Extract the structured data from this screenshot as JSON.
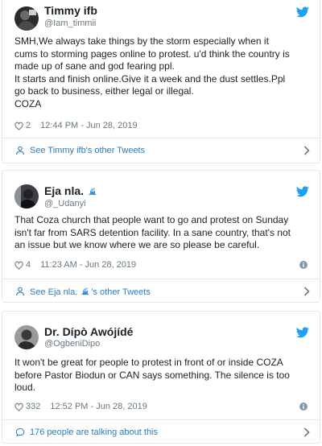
{
  "tweets": [
    {
      "name": "Timmy ifb",
      "handle": "@Iam_timmii",
      "text_lines": [
        "SMH,We always take things by the storm especially when it",
        "cums to storming pages online to protest. u'd think the country is",
        "made up of sane and god fearing ppl.",
        "It starts and finish online.Give it a week and the dust settles.Ppl",
        "go back to business, either legal or illegal.",
        "COZA"
      ],
      "likes": "2",
      "timestamp": "12:44 PM - Jun 28, 2019",
      "footer": "See Timmy ifb's other Tweets"
    },
    {
      "name": "Eja nla.",
      "handle": "@_Udanyi",
      "text_lines": [
        "That Coza church that people want to go and protest on Sunday",
        "isn't far from SARS detention facility. In a sane country, that's not",
        "an issue but we know where we are so please be careful."
      ],
      "likes": "4",
      "timestamp": "11:23 AM - Jun 28, 2019",
      "footer_prefix": "See Eja nla.",
      "footer_suffix": "'s other Tweets"
    },
    {
      "name": "Dr. Dípò Awójídé",
      "handle": "@OgbeniDipo",
      "text_lines": [
        "It won't be great for people to protest in front of or inside COZA",
        "before Pastor Biodun or CAN says something. The silence is too",
        "loud."
      ],
      "likes": "332",
      "timestamp": "12:52 PM - Jun 28, 2019",
      "footer": "176 people are talking about this"
    }
  ],
  "colors": {
    "twitter_blue": "#1da1f2",
    "link_blue": "#2b7bb9",
    "meta_gray": "#697882",
    "border": "#e1e8ed"
  },
  "icons": {
    "brand": "twitter-bird-icon",
    "like": "heart-icon",
    "info": "info-icon",
    "profile": "person-icon",
    "conversation": "speech-bubble-icon",
    "more": "chevron-right-icon",
    "emoji": "water-wave-emoji"
  }
}
